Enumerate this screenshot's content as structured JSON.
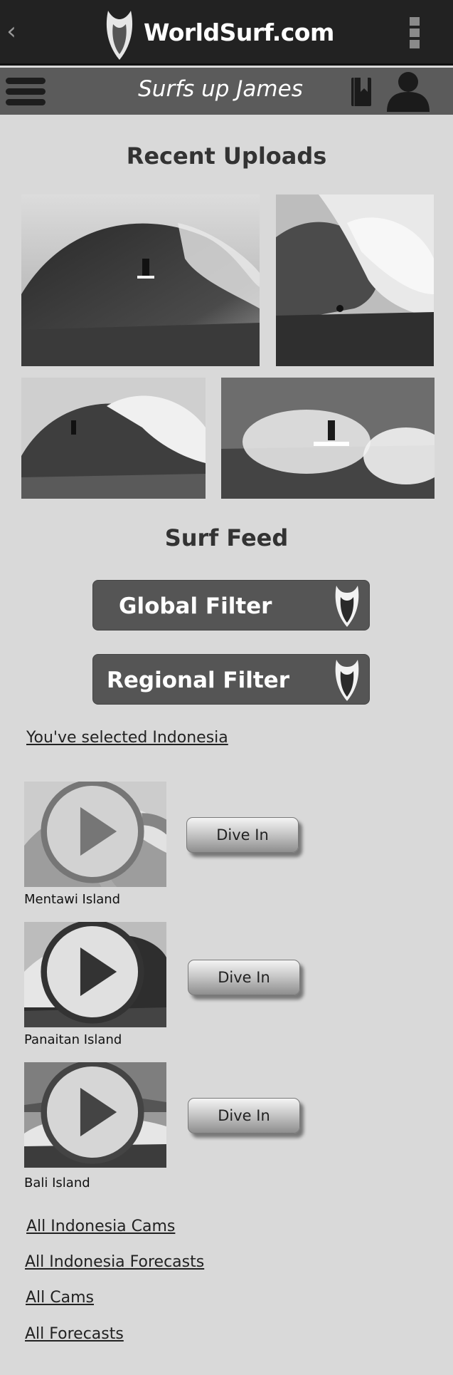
{
  "header": {
    "back_glyph": "‹",
    "brand_title": "WorldSurf.com",
    "logo_icon": "surfboard-logo-icon",
    "menu_icon": "kebab-menu-icon"
  },
  "subheader": {
    "greeting": "Surfs up James",
    "menu_icon": "hamburger-icon",
    "bookmark_icon": "bookmark-icon",
    "user_icon": "user-icon"
  },
  "recent_uploads": {
    "title": "Recent Uploads",
    "photos": [
      "surfer-barrel-photo",
      "big-wave-photo",
      "wave-drop-photo",
      "surfer-spray-photo"
    ]
  },
  "surf_feed": {
    "title": "Surf Feed",
    "global_filter_label": "Global Filter",
    "regional_filter_label": "Regional Filter",
    "selection_text": "You've selected Indonesia"
  },
  "spots": [
    {
      "name": "Mentawi Island",
      "button": "Dive In",
      "loading": true
    },
    {
      "name": "Panaitan Island",
      "button": "Dive In",
      "loading": false
    },
    {
      "name": "Bali Island",
      "button": "Dive In",
      "loading": false
    }
  ],
  "links": {
    "indonesia_cams": "All Indonesia Cams",
    "indonesia_forecasts": "All Indonesia Forecasts",
    "all_cams": "All Cams",
    "all_forecasts": "All Forecasts"
  },
  "colors": {
    "top_bar": "#222222",
    "sub_bar": "#5b5b5b",
    "background": "#d9d9d9",
    "filter_button": "#555555"
  }
}
